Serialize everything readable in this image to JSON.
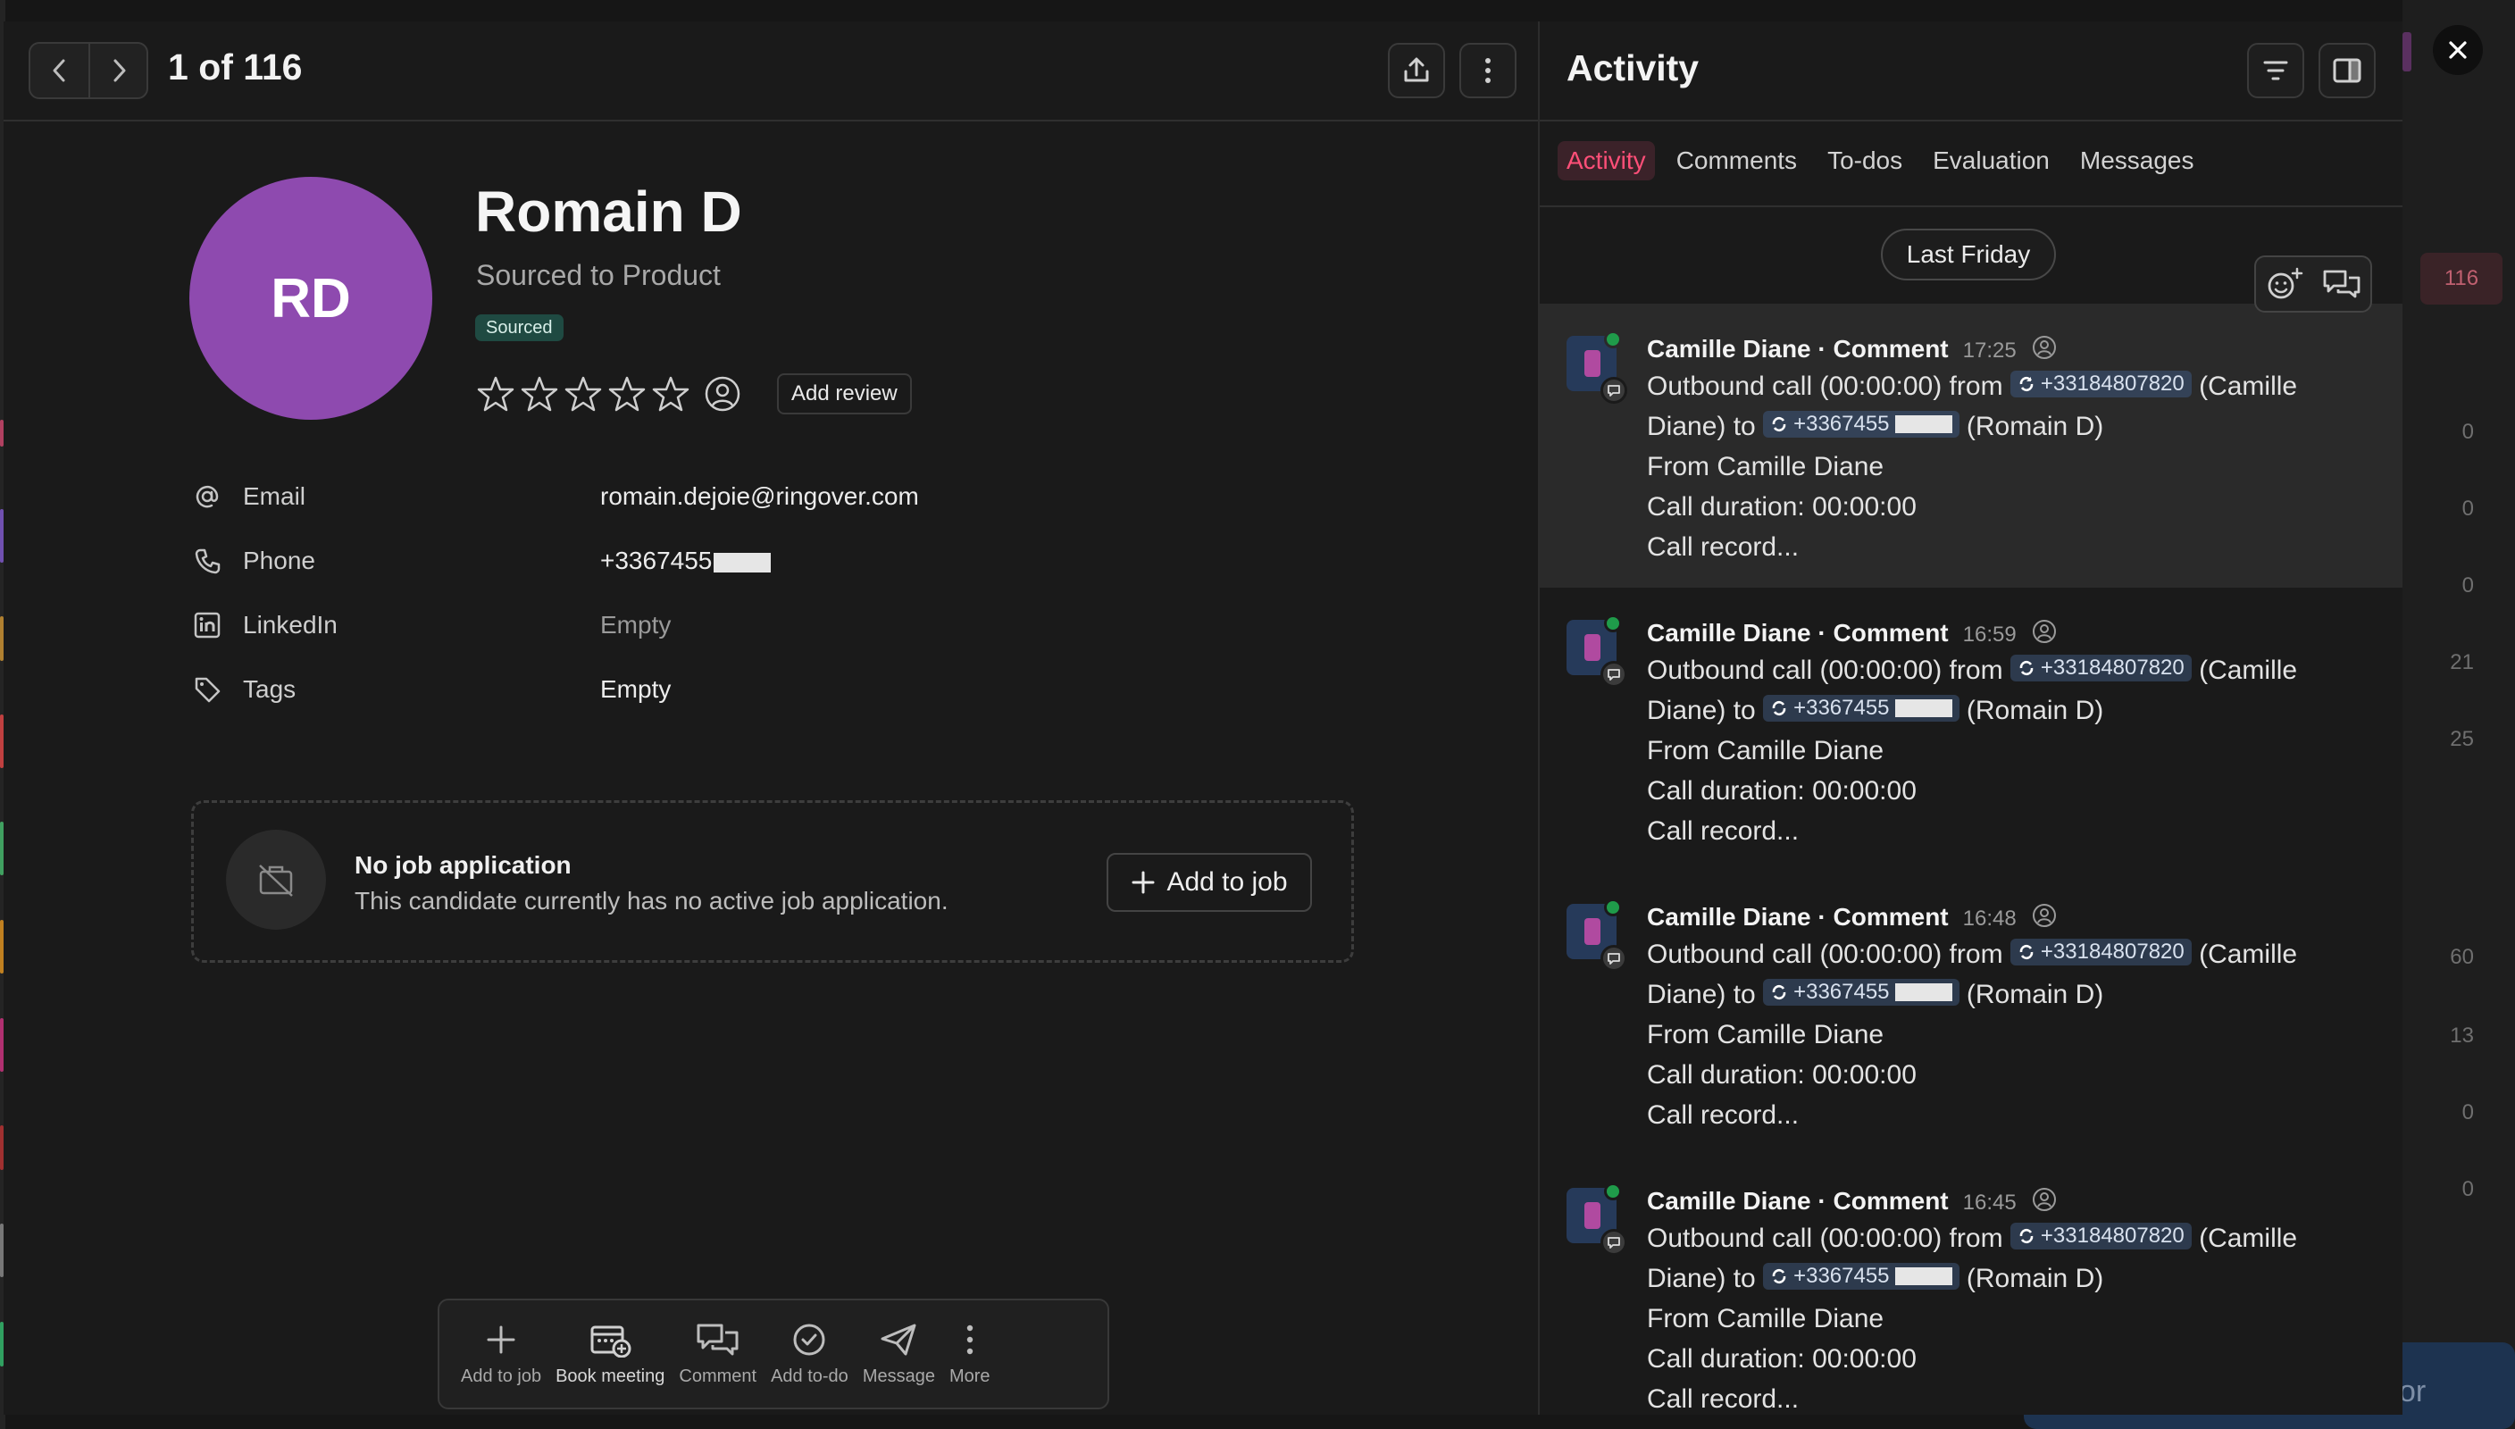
{
  "header": {
    "counter": "1 of 116"
  },
  "candidate": {
    "initials": "RD",
    "name": "Romain D",
    "subtitle": "Sourced to Product",
    "status": "Sourced",
    "add_review_label": "Add review",
    "rating_stars": 0,
    "fields": [
      {
        "label": "Email",
        "value": "romain.dejoie@ringover.com",
        "icon": "at-icon"
      },
      {
        "label": "Phone",
        "value": "+3367455",
        "icon": "phone-icon"
      },
      {
        "label": "LinkedIn",
        "value": "Empty",
        "icon": "linkedin-icon"
      },
      {
        "label": "Tags",
        "value": "Empty",
        "icon": "tag-icon"
      }
    ]
  },
  "job_application": {
    "title": "No job application",
    "description": "This candidate currently has no active job application.",
    "button": "Add to job"
  },
  "toolbar": [
    {
      "label": "Add to job",
      "icon": "plus-icon"
    },
    {
      "label": "Book meeting",
      "icon": "calendar-add-icon"
    },
    {
      "label": "Comment",
      "icon": "comments-icon"
    },
    {
      "label": "Add to-do",
      "icon": "check-circle-icon"
    },
    {
      "label": "Message",
      "icon": "send-icon"
    },
    {
      "label": "More",
      "icon": "more-vertical-icon"
    }
  ],
  "activity": {
    "title": "Activity",
    "tabs": [
      "Activity",
      "Comments",
      "To-dos",
      "Evaluation",
      "Messages"
    ],
    "active_tab": "Activity",
    "date_group": "Last Friday",
    "entries": [
      {
        "author": "Camille Diane · Comment",
        "time": "17:25",
        "line1_a": "Outbound call (00:00:00) from",
        "from_number": "+33184807820",
        "line1_b": "(Camille",
        "line2_a": "Diane) to",
        "to_number": "+3367455",
        "line2_b": "(Romain D)",
        "line3": "From Camille Diane",
        "line4": "Call duration: 00:00:00",
        "line5": "Call record..."
      },
      {
        "author": "Camille Diane · Comment",
        "time": "16:59",
        "line1_a": "Outbound call (00:00:00) from",
        "from_number": "+33184807820",
        "line1_b": "(Camille",
        "line2_a": "Diane) to",
        "to_number": "+3367455",
        "line2_b": "(Romain D)",
        "line3": "From Camille Diane",
        "line4": "Call duration: 00:00:00",
        "line5": "Call record..."
      },
      {
        "author": "Camille Diane · Comment",
        "time": "16:48",
        "line1_a": "Outbound call (00:00:00) from",
        "from_number": "+33184807820",
        "line1_b": "(Camille",
        "line2_a": "Diane) to",
        "to_number": "+3367455",
        "line2_b": "(Romain D)",
        "line3": "From Camille Diane",
        "line4": "Call duration: 00:00:00",
        "line5": "Call record..."
      },
      {
        "author": "Camille Diane · Comment",
        "time": "16:45",
        "line1_a": "Outbound call (00:00:00) from",
        "from_number": "+33184807820",
        "line1_b": "(Camille",
        "line2_a": "Diane) to",
        "to_number": "+3367455",
        "line2_b": "(Romain D)",
        "line3": "From Camille Diane",
        "line4": "Call duration: 00:00:00",
        "line5": "Call record..."
      }
    ]
  },
  "background": {
    "badge": "116",
    "numbers": [
      "0",
      "0",
      "0",
      "21",
      "25",
      "60",
      "13",
      "0",
      "0"
    ],
    "button_text": "or"
  },
  "colors": {
    "accent": "#ff4f78",
    "avatar": "#8e4aaf",
    "status_badge": "#1f4a42"
  }
}
